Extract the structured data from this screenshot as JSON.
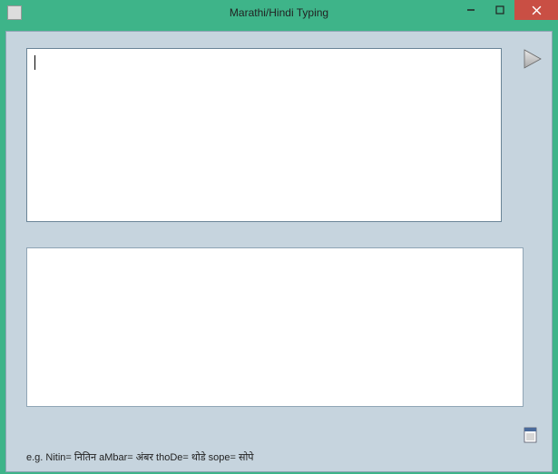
{
  "window": {
    "title": "Marathi/Hindi Typing"
  },
  "input": {
    "value": ""
  },
  "output": {
    "value": ""
  },
  "example": {
    "text": "e.g. Nitin= नितिन  aMbar= अंबर   thoDe= थोडे   sope= सोपे"
  }
}
